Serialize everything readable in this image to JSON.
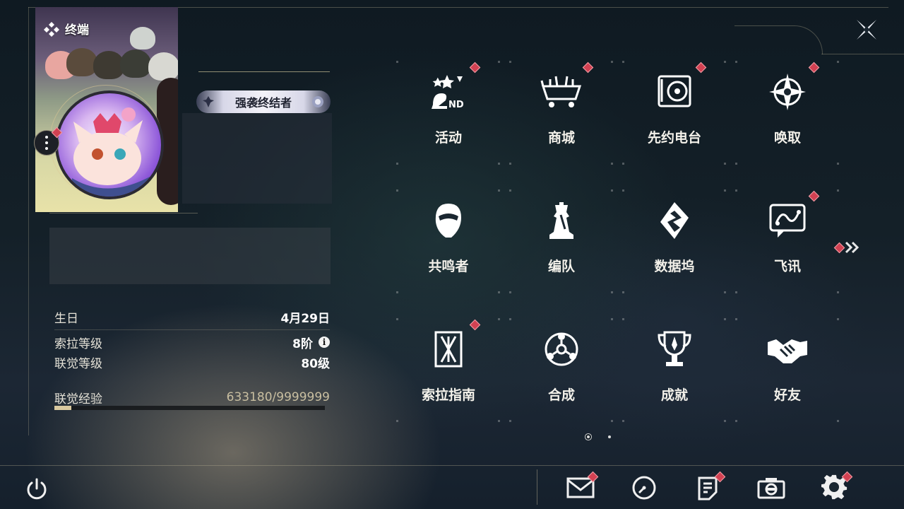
{
  "profile": {
    "terminal_label": "终端",
    "title_badge": "强袭终结者",
    "stats": [
      {
        "label": "生日",
        "value": "4月29日"
      },
      {
        "label": "索拉等级",
        "value": "8阶"
      },
      {
        "label": "联觉等级",
        "value": "80级"
      }
    ],
    "exp": {
      "label": "联觉经验",
      "value": "633180/9999999",
      "progress": 0.063
    },
    "info_glyph": "i"
  },
  "menu": {
    "items": [
      {
        "label": "活动",
        "icon": "event-2nd-icon",
        "badge": true
      },
      {
        "label": "商城",
        "icon": "shop-basket-icon",
        "badge": true
      },
      {
        "label": "先约电台",
        "icon": "radio-icon",
        "badge": true
      },
      {
        "label": "唤取",
        "icon": "summon-compass-icon",
        "badge": true
      },
      {
        "label": "共鸣者",
        "icon": "resonator-icon",
        "badge": false
      },
      {
        "label": "编队",
        "icon": "team-chess-icon",
        "badge": false
      },
      {
        "label": "数据坞",
        "icon": "data-bank-icon",
        "badge": false
      },
      {
        "label": "飞讯",
        "icon": "message-icon",
        "badge": true
      },
      {
        "label": "索拉指南",
        "icon": "guide-icon",
        "badge": true
      },
      {
        "label": "合成",
        "icon": "synthesis-icon",
        "badge": false
      },
      {
        "label": "成就",
        "icon": "achievement-trophy-icon",
        "badge": false
      },
      {
        "label": "好友",
        "icon": "friends-handshake-icon",
        "badge": false
      }
    ],
    "pages": 2,
    "current_page": 1
  },
  "bottom_bar": {
    "buttons": [
      {
        "name": "mail",
        "icon": "mail-icon",
        "badge": true
      },
      {
        "name": "time",
        "icon": "clock-icon",
        "badge": false
      },
      {
        "name": "notes",
        "icon": "notice-icon",
        "badge": true
      },
      {
        "name": "camera",
        "icon": "camera-icon",
        "badge": false
      },
      {
        "name": "settings",
        "icon": "gear-icon",
        "badge": true
      }
    ]
  },
  "colors": {
    "badge": "#d24152",
    "accent": "#d9c9a0",
    "text": "#f3f1ea"
  }
}
